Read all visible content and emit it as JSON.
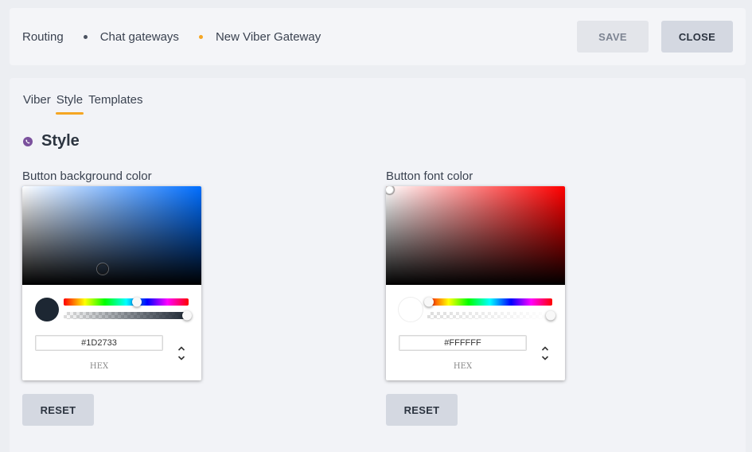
{
  "breadcrumb": {
    "items": [
      "Routing",
      "Chat gateways",
      "New Viber Gateway"
    ]
  },
  "toolbar": {
    "save_label": "SAVE",
    "close_label": "CLOSE"
  },
  "tabs": [
    {
      "label": "Viber",
      "active": false
    },
    {
      "label": "Style",
      "active": true
    },
    {
      "label": "Templates",
      "active": false
    }
  ],
  "section": {
    "title": "Style",
    "icon": "viber-icon"
  },
  "background_color": {
    "label": "Button background color",
    "hex_value": "#1D2733",
    "hex_label": "HEX",
    "reset_label": "RESET",
    "swatch_color": "#1d2733",
    "hue_color": "#006eff"
  },
  "font_color": {
    "label": "Button font color",
    "hex_value": "#FFFFFF",
    "hex_label": "HEX",
    "reset_label": "RESET",
    "swatch_color": "#ffffff",
    "hue_color": "#ff0000"
  },
  "colors": {
    "accent": "#f5a623",
    "viber": "#7b519d"
  }
}
